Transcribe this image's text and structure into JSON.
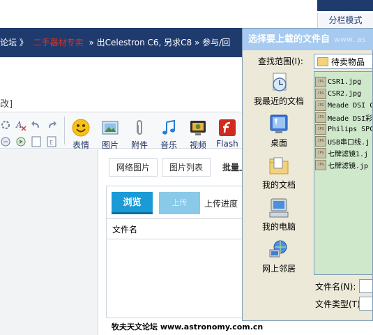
{
  "header": {
    "split_mode": "分栏模式",
    "breadcrumb": [
      "论坛 》",
      "二手器材专卖",
      "» 出Celestron C6, 另求C8 » 参与/回"
    ],
    "bracket_text": "改]"
  },
  "toolbar": {
    "buttons": [
      {
        "label": "表情",
        "icon": "smiley-icon"
      },
      {
        "label": "图片",
        "icon": "picture-icon"
      },
      {
        "label": "附件",
        "icon": "paperclip-icon"
      },
      {
        "label": "音乐",
        "icon": "music-icon"
      },
      {
        "label": "视频",
        "icon": "video-icon"
      },
      {
        "label": "Flash",
        "icon": "flash-icon"
      }
    ]
  },
  "upload": {
    "tabs": [
      "网络图片",
      "图片列表",
      "批量上"
    ],
    "browse": "浏览",
    "upload": "上传",
    "progress_label": "上传进度",
    "filename_header": "文件名"
  },
  "footer": {
    "site": "牧夫天文论坛 www.astronomy.com.cn"
  },
  "dialog": {
    "title": "选择要上载的文件自",
    "title_faint": "www. as",
    "lookin_label": "查找范围(I):",
    "lookin_value": "待卖物品",
    "places": [
      {
        "label": "我最近的文档",
        "icon": "recent-documents-icon"
      },
      {
        "label": "桌面",
        "icon": "desktop-icon"
      },
      {
        "label": "我的文档",
        "icon": "my-documents-icon"
      },
      {
        "label": "我的电脑",
        "icon": "my-computer-icon"
      },
      {
        "label": "网上邻居",
        "icon": "network-places-icon"
      }
    ],
    "files": [
      "CSR1.jpg",
      "CSR2.jpg",
      "Meade DSI C",
      "Meade DSI彩",
      "Philips SPC",
      "USB串口线.j",
      "七牌滤镜1.j",
      "七牌滤镜.jp"
    ],
    "filename_label": "文件名(N):",
    "filetype_label": "文件类型(T):"
  }
}
